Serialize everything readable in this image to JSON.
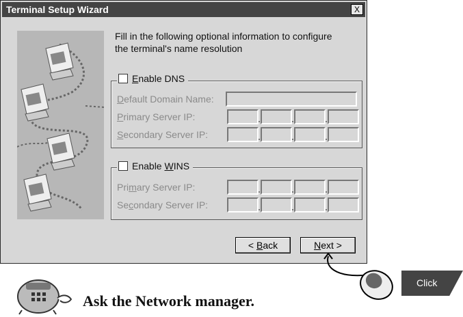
{
  "window": {
    "title": "Terminal Setup Wizard",
    "close_label": "X"
  },
  "intro_line1": "Fill in the following optional information to configure",
  "intro_line2": "the terminal's name resolution",
  "dns": {
    "checkbox_label_pre": "",
    "checkbox_label_u": "E",
    "checkbox_label_post": "nable DNS",
    "domain_label_u": "D",
    "domain_label_post": "efault Domain Name:",
    "primary_label_u": "P",
    "primary_label_post": "rimary Server IP:",
    "secondary_label_u": "S",
    "secondary_label_post": "econdary Server IP:"
  },
  "wins": {
    "checkbox_label_pre": "Enable ",
    "checkbox_label_u": "W",
    "checkbox_label_post": "INS",
    "primary_label_pre": "Pri",
    "primary_label_u": "m",
    "primary_label_post": "ary Server IP:",
    "secondary_label_pre": "Se",
    "secondary_label_u": "c",
    "secondary_label_post": "ondary Server IP:"
  },
  "buttons": {
    "back_pre": "< ",
    "back_u": "B",
    "back_post": "ack",
    "next_u": "N",
    "next_post": "ext >"
  },
  "callout": {
    "click_label": "Click",
    "note": "Ask the Network manager."
  },
  "colors": {
    "dialog_bg": "#d7d7d7",
    "titlebar_bg": "#444444",
    "disabled_text": "#8a8a8a"
  },
  "icons": [
    "network-computer-icon",
    "mouse-icon",
    "phone-mascot-icon"
  ]
}
